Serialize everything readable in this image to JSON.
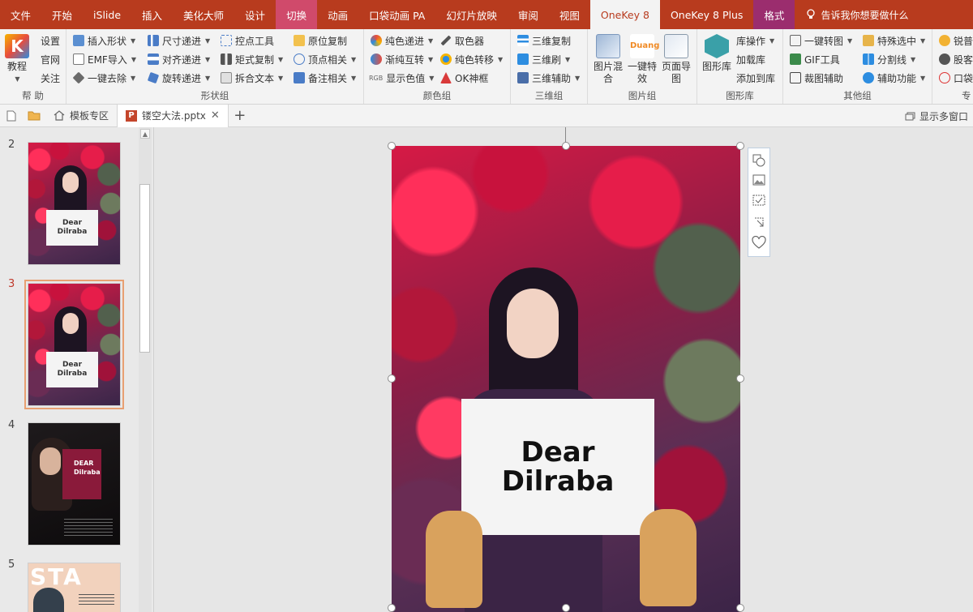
{
  "menu": {
    "items": [
      "文件",
      "开始",
      "iSlide",
      "插入",
      "美化大师",
      "设计",
      "切换",
      "动画",
      "口袋动画 PA",
      "幻灯片放映",
      "审阅",
      "视图",
      "OneKey 8",
      "OneKey 8 Plus",
      "格式"
    ],
    "search": "告诉我你想要做什么"
  },
  "ribbon": {
    "help": {
      "label": "帮 助",
      "big": "教程",
      "small": [
        "设置",
        "官网",
        "关注"
      ]
    },
    "shape": {
      "label": "形状组",
      "col1": [
        "插入形状",
        "EMF导入",
        "一键去除"
      ],
      "col2": [
        "尺寸递进",
        "对齐递进",
        "旋转递进"
      ],
      "col3": [
        "控点工具",
        "矩式复制",
        "拆合文本"
      ],
      "col4": [
        "原位复制",
        "顶点相关",
        "备注相关"
      ]
    },
    "color": {
      "label": "颜色组",
      "col1": [
        "纯色递进",
        "渐纯互转",
        "显示色值"
      ],
      "col2": [
        "取色器",
        "纯色转移",
        "OK神框"
      ]
    },
    "threed": {
      "label": "三维组",
      "items": [
        "三维复制",
        "三维刷",
        "三维辅助"
      ]
    },
    "picture": {
      "label": "图片组",
      "big": [
        "图片混合",
        "一键特效",
        "页面导图"
      ],
      "duang": "Duang"
    },
    "shapelib": {
      "label": "图形库",
      "big": "图形库",
      "small": [
        "库操作",
        "加载库",
        "添加到库"
      ]
    },
    "other": {
      "label": "其他组",
      "col1": [
        "一键转图",
        "GIF工具",
        "裁图辅助"
      ],
      "col2": [
        "特殊选中",
        "分割线",
        "辅助功能"
      ],
      "col3": [
        "锐普",
        "股客",
        "口袋"
      ]
    },
    "partial_label": "专"
  },
  "tabs": {
    "template": "模板专区",
    "file": "镂空大法.pptx",
    "show_multi": "显示多窗口"
  },
  "thumbnails": [
    {
      "num": "2",
      "text1": "Dear",
      "text2": "Dilraba",
      "active": false
    },
    {
      "num": "3",
      "text1": "Dear",
      "text2": "Dilraba",
      "active": true
    },
    {
      "num": "4",
      "text1": "DEAR",
      "text2": "Dilraba",
      "active": false
    },
    {
      "num": "5",
      "text1": "STA",
      "text2": "",
      "active": false
    }
  ],
  "slide": {
    "line1": "Dear",
    "line2": "Dilraba"
  },
  "colors": {
    "menu_bg": "#b83b1e",
    "active_tab": "#f3f3f3",
    "accent": "#c0392b",
    "format_tab": "#9b2d6e"
  }
}
